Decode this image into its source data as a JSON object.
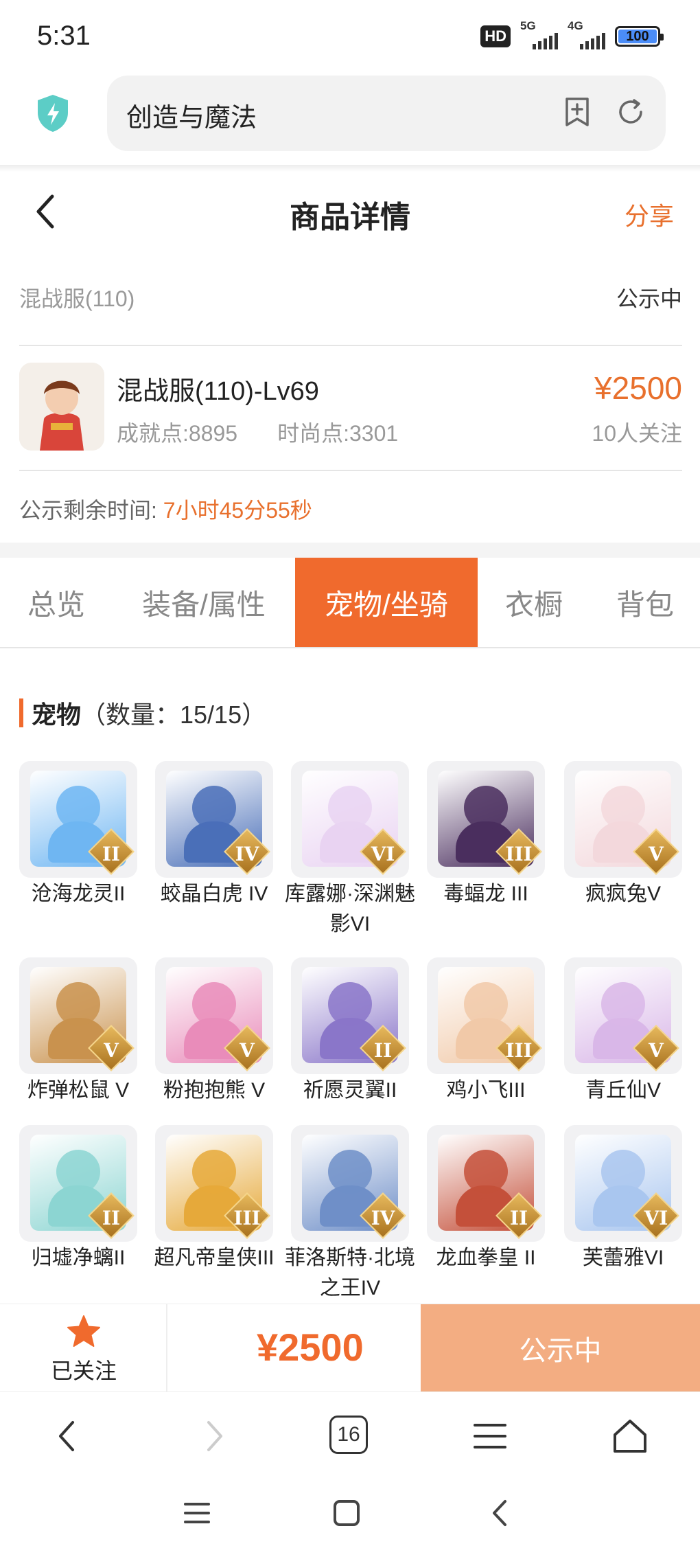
{
  "status_bar": {
    "time": "5:31",
    "hd": "HD",
    "net1": "5G",
    "net2": "4G",
    "battery": "100"
  },
  "browser": {
    "url_text": "创造与魔法"
  },
  "header": {
    "title": "商品详情",
    "share": "分享"
  },
  "listing": {
    "server": "混战服(110)",
    "status": "公示中",
    "char_name": "混战服(110)-Lv69",
    "achievement": "成就点:8895",
    "fashion": "时尚点:3301",
    "price": "¥2500",
    "followers": "10人关注",
    "countdown_label": "公示剩余时间:",
    "countdown_value": "7小时45分55秒"
  },
  "tabs": [
    {
      "label": "总览",
      "active": false
    },
    {
      "label": "装备/属性",
      "active": false
    },
    {
      "label": "宠物/坐骑",
      "active": true
    },
    {
      "label": "衣橱",
      "active": false
    },
    {
      "label": "背包",
      "active": false
    }
  ],
  "pets_section": {
    "title": "宠物",
    "count": "（数量：15/15）"
  },
  "pets": [
    {
      "name": "沧海龙灵II",
      "rank": "II",
      "color": "#6fb6f2"
    },
    {
      "name": "蛟晶白虎 IV",
      "rank": "IV",
      "color": "#4a6fb8"
    },
    {
      "name": "库露娜·深渊魅影VI",
      "rank": "VI",
      "color": "#e9d3f2"
    },
    {
      "name": "毒蝠龙 III",
      "rank": "III",
      "color": "#4a2e5e"
    },
    {
      "name": "疯疯兔V",
      "rank": "V",
      "color": "#f3d8dc"
    },
    {
      "name": "炸弹松鼠 V",
      "rank": "V",
      "color": "#c9924e"
    },
    {
      "name": "粉抱抱熊 V",
      "rank": "V",
      "color": "#e98cba"
    },
    {
      "name": "祈愿灵翼II",
      "rank": "II",
      "color": "#8a76c9"
    },
    {
      "name": "鸡小飞III",
      "rank": "III",
      "color": "#f1c9a8"
    },
    {
      "name": "青丘仙V",
      "rank": "V",
      "color": "#d9b7e8"
    },
    {
      "name": "归墟净螭II",
      "rank": "II",
      "color": "#8cd5d2"
    },
    {
      "name": "超凡帝皇侠III",
      "rank": "III",
      "color": "#e6a93a"
    },
    {
      "name": "菲洛斯特·北境之王IV",
      "rank": "IV",
      "color": "#6f8fc8"
    },
    {
      "name": "龙血拳皇 II",
      "rank": "II",
      "color": "#c4503a"
    },
    {
      "name": "芙蕾雅VI",
      "rank": "VI",
      "color": "#a9c6ef"
    }
  ],
  "action_bar": {
    "follow_label": "已关注",
    "price": "¥2500",
    "status_button": "公示中"
  },
  "browser_nav": {
    "tab_count": "16"
  },
  "colors": {
    "accent": "#f06a2d",
    "accent_light": "#f3ad82"
  }
}
